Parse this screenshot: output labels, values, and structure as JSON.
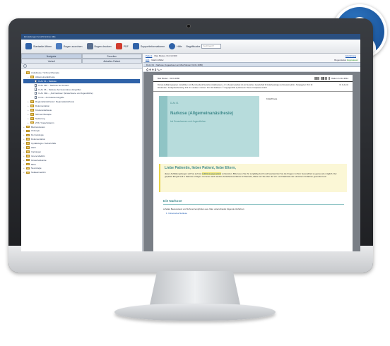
{
  "app": {
    "menubar_text": "Einstellungen  Ansicht  Extras  Hilfe"
  },
  "toolbar": {
    "buttons": [
      {
        "label": "Startseite öffnen",
        "icon": "home-icon",
        "color": "#2f62a8"
      },
      {
        "label": "Bogen zuordnen",
        "icon": "assign-icon",
        "color": "#2f62a8"
      },
      {
        "label": "Bogen drucken",
        "icon": "print-icon",
        "color": "#2f62a8"
      },
      {
        "label": "PDF",
        "icon": "pdf-icon",
        "color": "#d13b2e"
      },
      {
        "label": "Supportinformationen",
        "icon": "info-icon",
        "color": "#2f62a8"
      },
      {
        "label": "Hilfe",
        "icon": "help-icon",
        "color": "#2f62a8"
      }
    ],
    "search_label": "Begriffsuche",
    "search_placeholder": "Suchbegriff"
  },
  "left_panel": {
    "tabs": [
      "Navigator",
      "Favoriten"
    ],
    "tabs2": [
      "Verlauf",
      "Aktuelles Patient"
    ],
    "tree": [
      {
        "label": "Anästhesie / Schmerztherapie",
        "type": "folder",
        "level": 0,
        "expanded": true
      },
      {
        "label": "Allgemeinanästhesie",
        "type": "folder",
        "level": 1,
        "expanded": true
      },
      {
        "label": "D-An 01 – Narkose",
        "type": "doc",
        "level": 2,
        "selected": true
      },
      {
        "label": "D-An 01K – Narkose bei Kindern",
        "type": "doc",
        "level": 2
      },
      {
        "label": "D-An 06 – Narkose bei besonderen Eingriffen",
        "type": "doc",
        "level": 2
      },
      {
        "label": "D-An 01E – „Kurznarkose“ (Erwachsene und Jugendliche)",
        "type": "doc",
        "level": 2
      },
      {
        "label": "D-Ca – Ambulante Eingriffe",
        "type": "doc",
        "level": 2
      },
      {
        "label": "Regionalanästhesie / Regionalanästhesie",
        "type": "folder",
        "level": 1
      },
      {
        "label": "Dokumentation",
        "type": "folder",
        "level": 1
      },
      {
        "label": "Kinderanästhesie",
        "type": "folder",
        "level": 1
      },
      {
        "label": "Schmerztherapie",
        "type": "folder",
        "level": 1
      },
      {
        "label": "Sedierung",
        "type": "folder",
        "level": 1
      },
      {
        "label": "ZVK / Katecholamin",
        "type": "folder",
        "level": 1
      },
      {
        "label": "Bluttransfusion",
        "type": "folder",
        "level": 0
      },
      {
        "label": "Chirurgie",
        "type": "folder",
        "level": 0
      },
      {
        "label": "Dermatologie",
        "type": "folder",
        "level": 0
      },
      {
        "label": "Dokumentation",
        "type": "folder",
        "level": 0
      },
      {
        "label": "Gynäkologie / Geburtshilfe",
        "type": "folder",
        "level": 0
      },
      {
        "label": "HNO",
        "type": "folder",
        "level": 0
      },
      {
        "label": "Impfungen",
        "type": "folder",
        "level": 0
      },
      {
        "label": "Innere Medizin",
        "type": "folder",
        "level": 0
      },
      {
        "label": "Kinderheilkunde",
        "type": "folder",
        "level": 0
      },
      {
        "label": "MKG",
        "type": "folder",
        "level": 0
      },
      {
        "label": "Neurologie",
        "type": "folder",
        "level": 0
      },
      {
        "label": "Nuklearmedizin",
        "type": "folder",
        "level": 0
      }
    ]
  },
  "right_panel": {
    "patient_link": "Patient",
    "patient_value": "Max Muster, 01.01.1960",
    "arzt_link": "Arzt",
    "arzt_value": "Martin Müller",
    "abrechnung_link": "Einrichtung",
    "status_label": "Bogenstatus",
    "status_value": "Zugewiesen",
    "doc_title": "D-An 01 · Narkose (zugewiesen an Max Muster 01.01.1960)",
    "doc_tools": "⎙  ⊕  ⊖  ⊠  ✎  ▾"
  },
  "document": {
    "header_left": "Max Muster · 01.01.1960",
    "header_right": "Datum: 12.12.2014",
    "meta_text": "Diomed-Aufklärungssystem • Empfohlen vom Berufsverband Deutscher Anästhesisten e.V. in Zusammenarbeit mit der Deutschen Gesellschaft für Anästhesiologie und Intensivmedizin • Herausgeber: Prof. Dr. Wiedemann • Fachgebietsberatung: Prof. Dr. Landauer • Autoren: Prof. Dr. Weißauer • © Copyright 2011 by Diomed in Thieme Compliance GmbH",
    "meta_nr": "Nr. D-An 01",
    "teal_small": "D-An 01",
    "teal_title": "Narkose (Allgemeinanästhesie)",
    "teal_sub": "bei Erwachsenen und Jugendlichen",
    "patient_label": "Klinik/Praxis",
    "yellow_title": "Liebe Patientin, lieber Patient, liebe Eltern,",
    "yellow_text_a": "dieser Aufklärungsbogen soll Sie auf das",
    "yellow_text_hl": "Aufklärungsgespräch",
    "yellow_text_b": "vorbereiten. Bitte lesen Sie ihn sorgfältig durch und beantworten Sie die Fragen zu Ihrer Gesundheit so genau wie möglich. Der geplante Eingriff soll in Narkose erfolgen. Kommen auch andere Anästhesieverfahren in Betracht, klären wir Sie über die Vor- und Nachteile der einzelnen Verfahren gesondert auf.",
    "section_title": "Die Narkose",
    "section_text": "schaltet Bewusstsein und Schmerzempfinden aus. Man unterscheidet folgende Verfahren:",
    "section_list": "1. Intravenöse Narkose"
  }
}
